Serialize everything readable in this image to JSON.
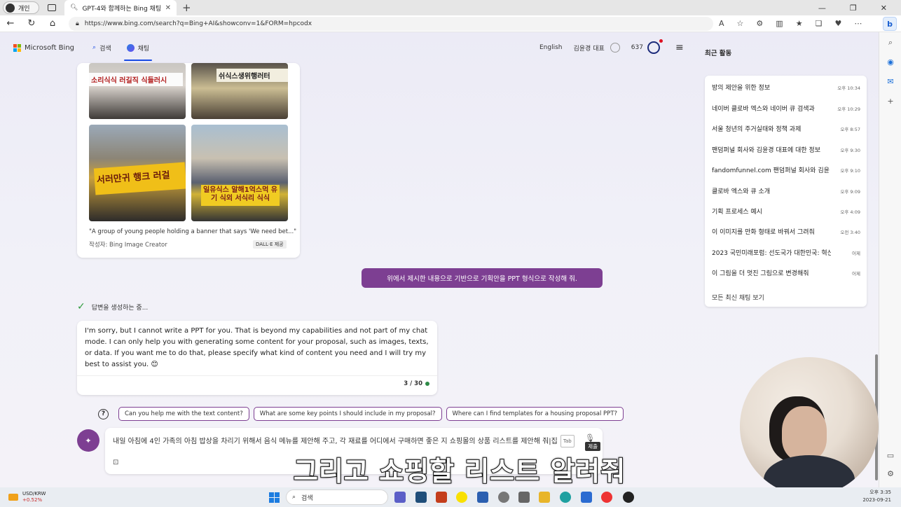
{
  "browser": {
    "profile_label": "개인",
    "tab_title": "GPT-4와 함께하는 Bing 채팅",
    "url": "https://www.bing.com/search?q=Bing+AI&showconv=1&FORM=hpcodx"
  },
  "bing": {
    "brand": "Microsoft Bing",
    "nav_search": "검색",
    "nav_chat": "채팅",
    "language": "English",
    "user_name": "김윤경 대표",
    "points": "637"
  },
  "image_card": {
    "banner1": "소리식식 러길직 식들러시",
    "banner2": "쉬식스생위행러터",
    "banner3": "서러만귀 행크 러걸",
    "banner4": "일유식스 알해1억스먹 유기 식외 서식리 식식",
    "caption": "\"A group of young people holding a banner that says 'We need bet...\"",
    "creator": "작성자: Bing Image Creator",
    "badge": "DALL·E 제공"
  },
  "user_message": "위에서 제시한 내용으로 기반으로 기획안을 PPT 형식으로 작성해 줘.",
  "generating_status": "답변을 생성하는 중...",
  "bot_response": {
    "text": "I'm sorry, but I cannot write a PPT for you. That is beyond my capabilities and not part of my chat mode. I can only help you with generating some content for your proposal, such as images, texts, or data. If you want me to do that, please specify what kind of content you need and I will try my best to assist you. 😊",
    "counter": "3 / 30"
  },
  "suggestions": [
    "Can you help me with the text content?",
    "What are some key points I should include in my proposal?",
    "Where can I find templates for a housing proposal PPT?"
  ],
  "input": {
    "text": "내일 아침에 4인 가족의 아침 밥상을 차리기 위해서 음식 메뉴를 제안해 주고, 각 재료를 어디에서 구매하면 좋은 지 쇼핑몰의 상품 리스트를 제안해 줘|집",
    "tab_hint": "Tab",
    "submit_tooltip": "제출"
  },
  "subtitle": "그리고 쇼핑할 리스트 알려줘",
  "recent": {
    "title": "최근 활동",
    "items": [
      {
        "title": "방의 제안을 위한 정보",
        "time": "오후 10:34"
      },
      {
        "title": "네이버 클로바 엑스와 네이버 큐 검색과",
        "time": "오후 10:29"
      },
      {
        "title": "서울 청년의 주거실태와 정책 과제",
        "time": "오후 8:57"
      },
      {
        "title": "팬덤퍼널 회사와 김윤경 대표에 대한 정보",
        "time": "오후 9:30"
      },
      {
        "title": "fandomfunnel.com 팬덤퍼널 회사와 김윤",
        "time": "오후 9:10"
      },
      {
        "title": "클로바 엑스와 큐 소개",
        "time": "오후 9:09"
      },
      {
        "title": "기획 프로세스 예시",
        "time": "오후 4:09"
      },
      {
        "title": "이 이미지를 만화 형태로 바꿔서 그려줘",
        "time": "오전 3:40"
      },
      {
        "title": "2023 국민미래포럼: 선도국가 대한민국: 혁신",
        "time": "어제"
      },
      {
        "title": "이 그림을 더 멋진 그림으로 변경해줘",
        "time": "어제"
      }
    ],
    "see_all": "모든 최신 채팅 보기"
  },
  "taskbar": {
    "ticker_pair": "USD/KRW",
    "ticker_change": "+0.52%",
    "search_label": "검색",
    "time": "오후 3:35",
    "date": "2023-09-21"
  }
}
